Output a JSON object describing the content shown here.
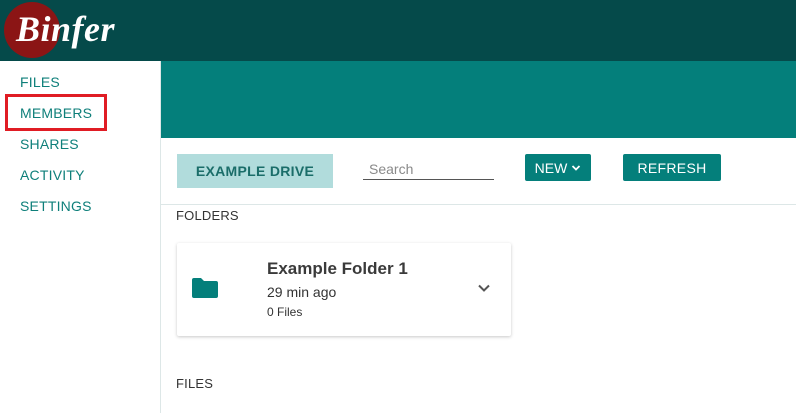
{
  "brand": {
    "name": "Binfer",
    "colors": {
      "header": "#054a4a",
      "accent": "#047f7b",
      "logo_circle": "#8b1515",
      "highlight": "#e01c24"
    }
  },
  "sidebar": {
    "items": [
      {
        "label": "FILES"
      },
      {
        "label": "MEMBERS",
        "highlighted": true
      },
      {
        "label": "SHARES"
      },
      {
        "label": "ACTIVITY"
      },
      {
        "label": "SETTINGS"
      }
    ]
  },
  "toolbar": {
    "drive_label": "EXAMPLE DRIVE",
    "search_placeholder": "Search",
    "new_label": "NEW",
    "refresh_label": "REFRESH"
  },
  "sections": {
    "folders_label": "FOLDERS",
    "files_label": "FILES"
  },
  "folders": [
    {
      "name": "Example Folder 1",
      "modified": "29 min ago",
      "file_count": "0 Files",
      "icon": "folder-icon"
    }
  ]
}
